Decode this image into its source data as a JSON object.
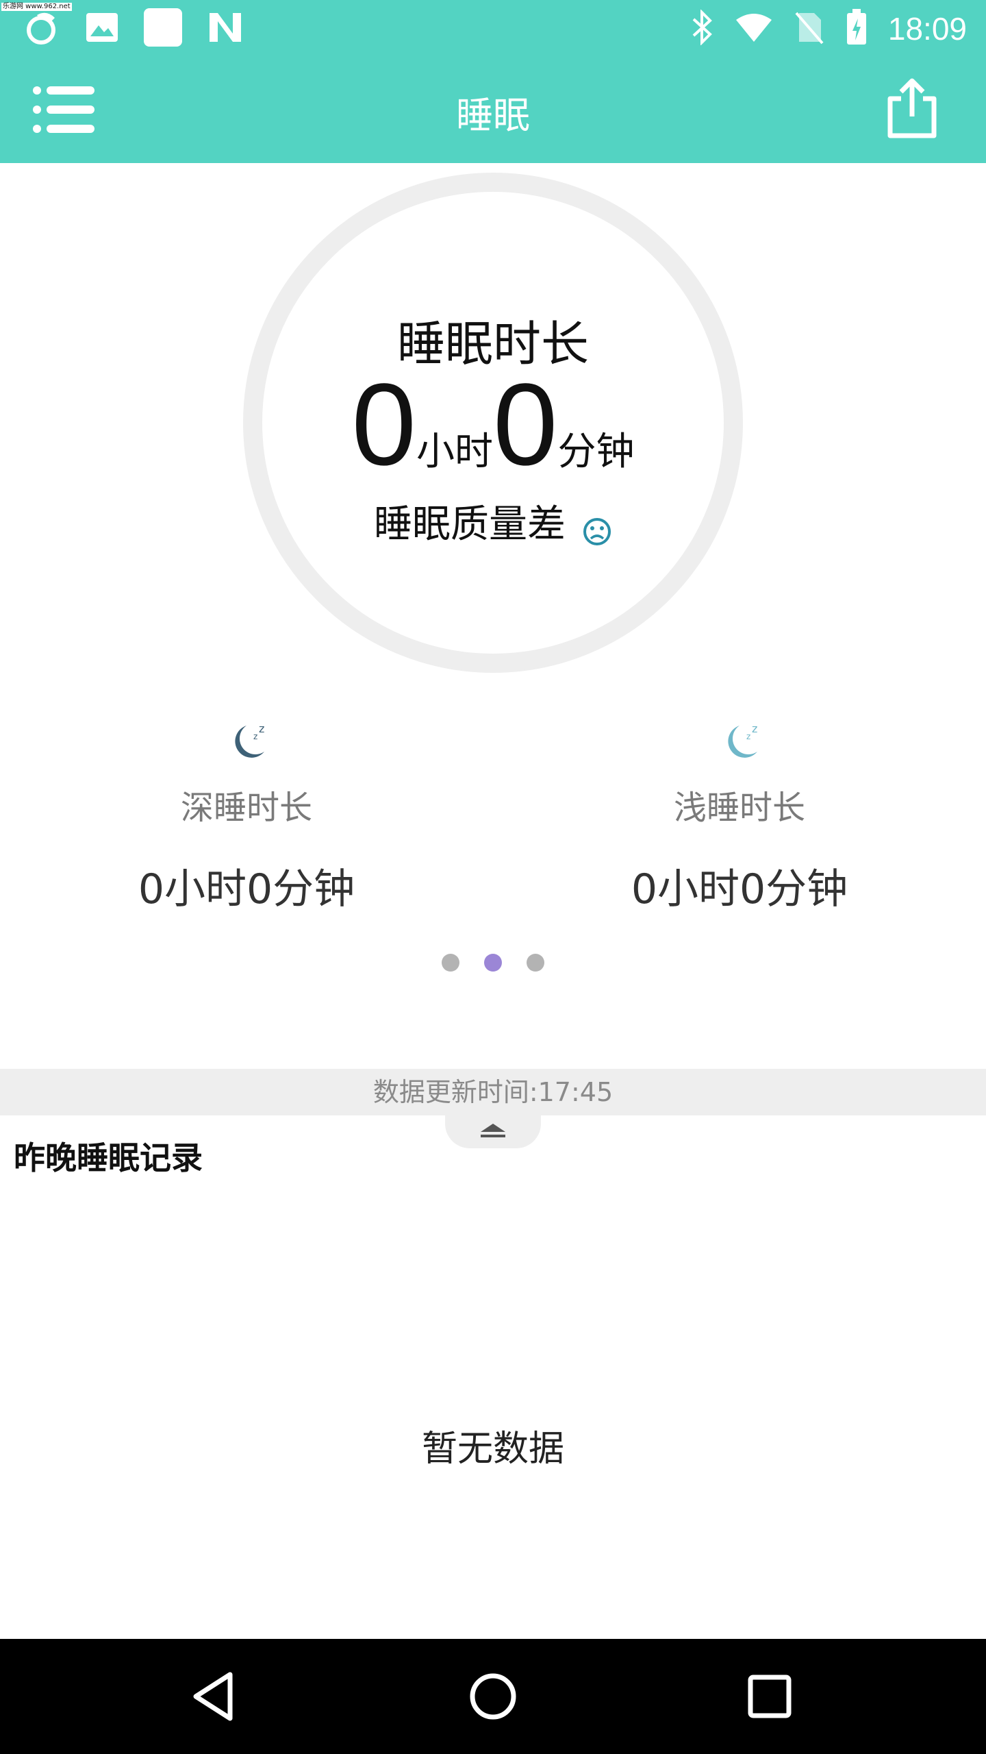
{
  "status_bar": {
    "watermark": "乐游网 www.962.net",
    "time": "18:09",
    "icons_left": [
      "uc-browser-icon",
      "gallery-icon",
      "blank-app-icon",
      "n-icon"
    ],
    "icons_right": [
      "bluetooth-icon",
      "wifi-icon",
      "no-sim-icon",
      "battery-icon"
    ]
  },
  "app_bar": {
    "title": "睡眠",
    "menu_icon": "list-menu-icon",
    "share_icon": "share-icon",
    "color": "#53d3c2"
  },
  "summary": {
    "title": "睡眠时长",
    "hours": "0",
    "hours_unit": "小时",
    "minutes": "0",
    "minutes_unit": "分钟",
    "quality": "睡眠质量差",
    "quality_icon": "sad-face-icon"
  },
  "deep_sleep": {
    "label": "深睡时长",
    "value": "0小时0分钟",
    "icon": "moon-dark-icon"
  },
  "light_sleep": {
    "label": "浅睡时长",
    "value": "0小时0分钟",
    "icon": "moon-light-icon"
  },
  "pager": {
    "count": 3,
    "active_index": 1
  },
  "update_bar": {
    "text": "数据更新时间:17:45"
  },
  "records": {
    "title": "昨晚睡眠记录",
    "empty_text": "暂无数据"
  },
  "nav_bar": {
    "icons": [
      "back-icon",
      "home-icon",
      "recents-icon"
    ]
  }
}
